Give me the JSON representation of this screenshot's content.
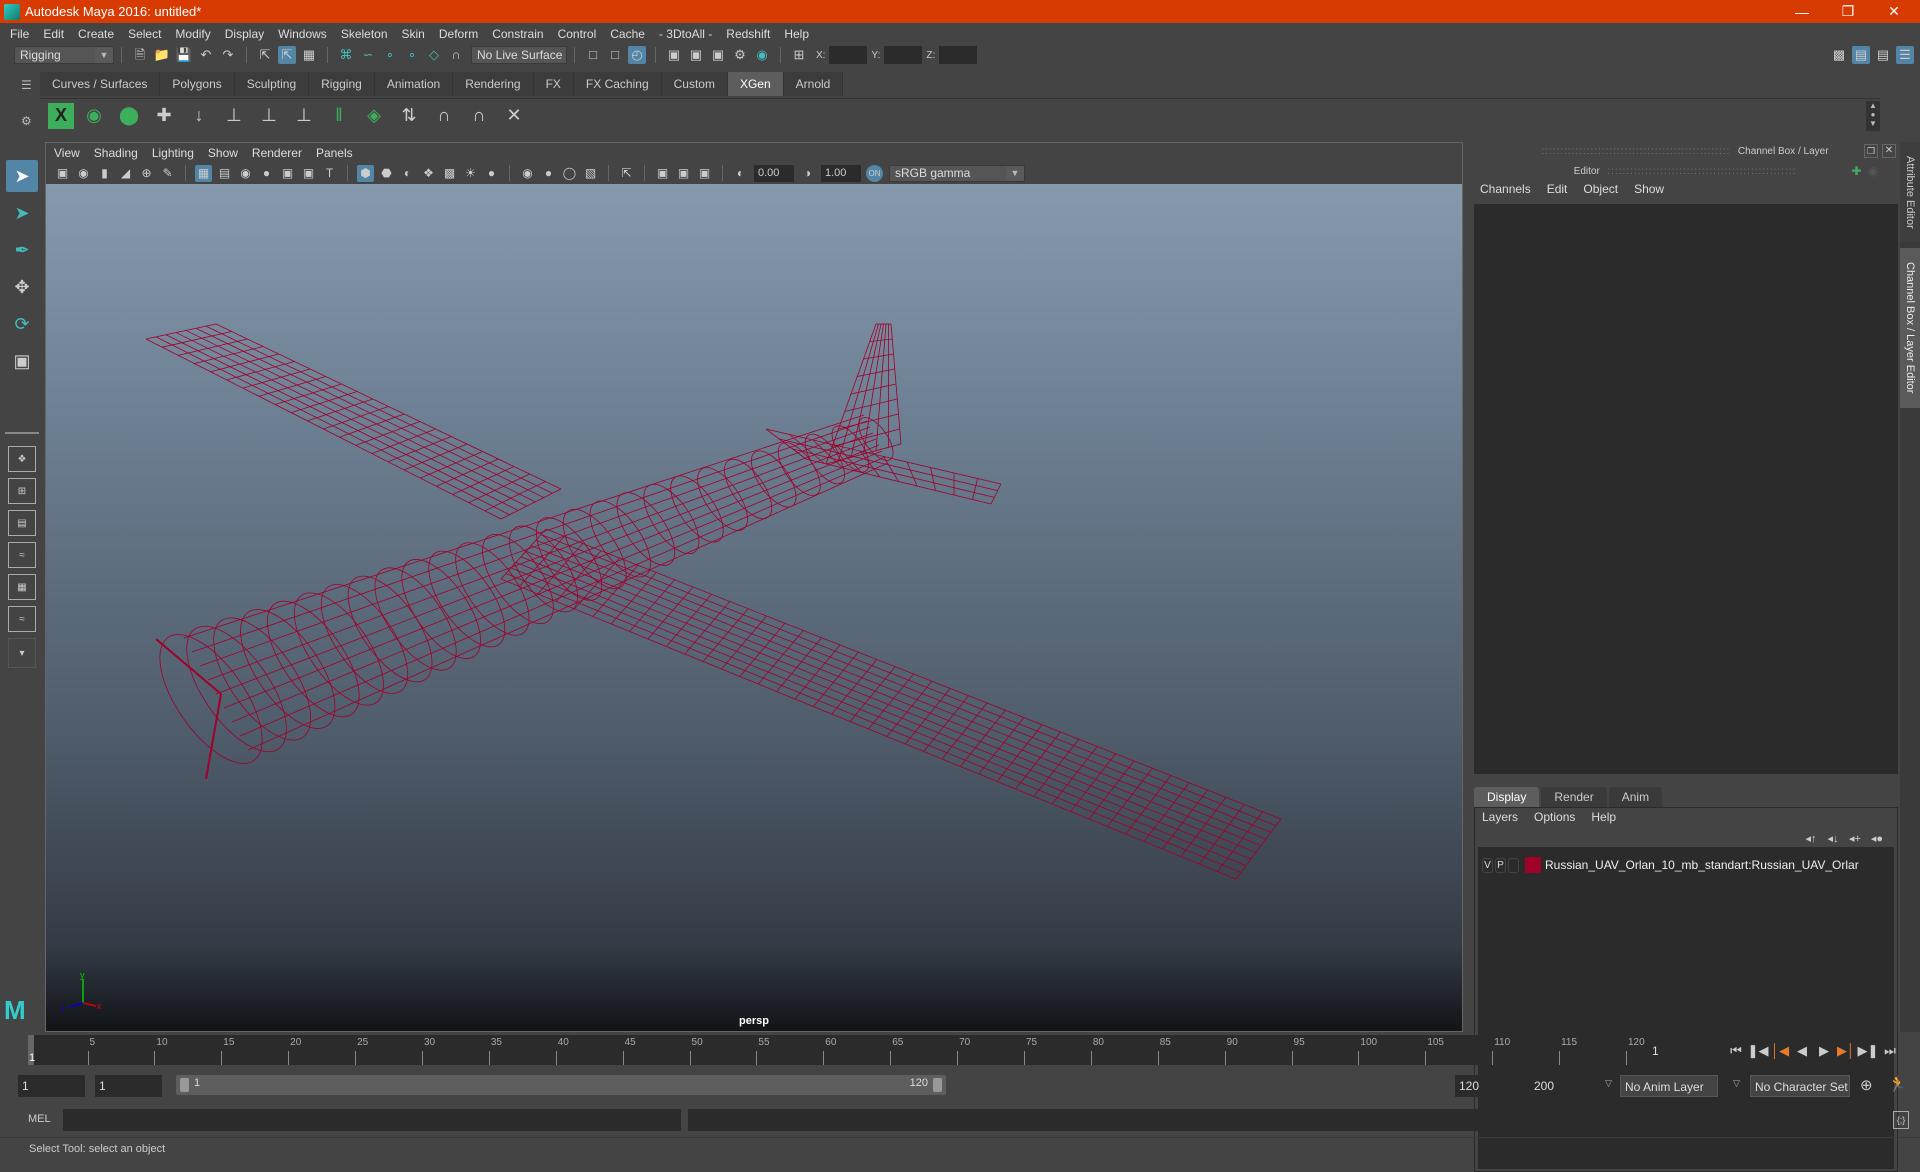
{
  "window": {
    "title": "Autodesk Maya 2016: untitled*",
    "controls": [
      "minimize",
      "restore",
      "close"
    ]
  },
  "menubar": [
    "File",
    "Edit",
    "Create",
    "Select",
    "Modify",
    "Display",
    "Windows",
    "Skeleton",
    "Skin",
    "Deform",
    "Constrain",
    "Control",
    "Cache",
    "- 3DtoAll -",
    "Redshift",
    "Help"
  ],
  "statusline": {
    "menuset": "Rigging",
    "live_surface": "No Live Surface",
    "x_label": "X:",
    "y_label": "Y:",
    "z_label": "Z:"
  },
  "shelf": {
    "tabs": [
      "Curves / Surfaces",
      "Polygons",
      "Sculpting",
      "Rigging",
      "Animation",
      "Rendering",
      "FX",
      "FX Caching",
      "Custom",
      "XGen",
      "Arnold"
    ],
    "active_tab": "XGen"
  },
  "panel": {
    "menu": [
      "View",
      "Shading",
      "Lighting",
      "Show",
      "Renderer",
      "Panels"
    ],
    "exposure": "0.00",
    "gamma": "1.00",
    "color_space": "sRGB gamma",
    "camera": "persp",
    "axis": {
      "x": "x",
      "y": "y",
      "z": "z"
    }
  },
  "channelbox": {
    "title": "Channel Box / Layer Editor",
    "menu": [
      "Channels",
      "Edit",
      "Object",
      "Show"
    ],
    "layer_tabs": [
      "Display",
      "Render",
      "Anim"
    ],
    "active_layer_tab": "Display",
    "layer_menu": [
      "Layers",
      "Options",
      "Help"
    ],
    "layers": [
      {
        "v": "V",
        "p": "P",
        "color": "#a0002a",
        "name": "Russian_UAV_Orlan_10_mb_standart:Russian_UAV_Orlar"
      }
    ]
  },
  "sidetabs": [
    "Attribute Editor",
    "Channel Box / Layer Editor"
  ],
  "timeline": {
    "start": 1,
    "end": 120,
    "ticks": [
      "5",
      "10",
      "15",
      "20",
      "25",
      "30",
      "35",
      "40",
      "45",
      "50",
      "55",
      "60",
      "65",
      "70",
      "75",
      "80",
      "85",
      "90",
      "95",
      "100",
      "105",
      "110",
      "115",
      "120"
    ],
    "current_frame": "1",
    "playhead_label": "1"
  },
  "range": {
    "start": "1",
    "anim_start": "1",
    "slider_start": "1",
    "slider_end": "120",
    "range_end": "120",
    "anim_end": "200",
    "anim_layer": "No Anim Layer",
    "character_set": "No Character Set"
  },
  "mel": {
    "label": "MEL"
  },
  "helpline": "Select Tool: select an object",
  "colors": {
    "titlebar": "#d83b01",
    "accent": "#5285a6",
    "wire": "#a0002a"
  }
}
